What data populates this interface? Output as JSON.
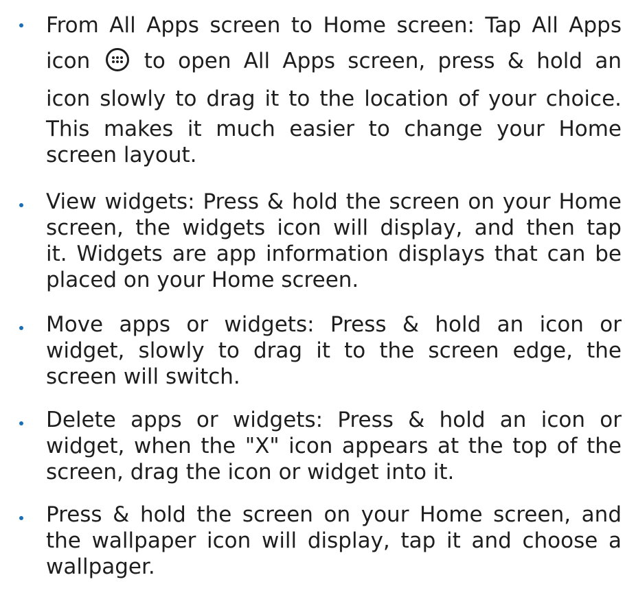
{
  "bullets": [
    {
      "lines": [
        "From All Apps screen to Home screen: Tap All Apps",
        "icon",
        "to open All Apps screen, press & hold an",
        "icon slowly to drag it to the location of your choice.",
        "This makes it much easier to change your Home",
        "screen layout."
      ],
      "icon": "all-apps-icon"
    },
    {
      "lines": [
        "View widgets: Press & hold the screen on your Home",
        "screen, the widgets icon will display, and then tap",
        "it. Widgets are app information displays that can be",
        "placed on your Home screen."
      ]
    },
    {
      "lines": [
        "Move apps or widgets: Press & hold an icon or",
        "widget, slowly to drag it to the screen edge, the",
        "screen will switch."
      ]
    },
    {
      "lines": [
        "Delete apps or widgets: Press & hold an icon or",
        "widget, when the \"X\" icon appears at the top of the",
        "screen, drag the icon or widget into it."
      ]
    },
    {
      "lines": [
        "Press & hold the screen on your Home screen, and",
        "the wallpaper icon will display, tap it and choose a",
        "wallpager."
      ]
    }
  ],
  "colors": {
    "bullet": "#1a6fb5",
    "text": "#1e1e1e"
  }
}
